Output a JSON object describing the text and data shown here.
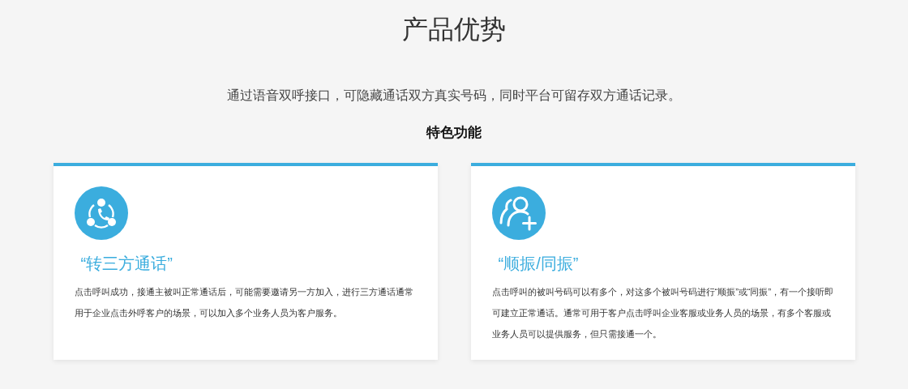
{
  "heading": "产品优势",
  "intro": "通过语音双呼接口，可隐藏通话双方真实号码，同时平台可留存双方通话记录。",
  "section_title": "特色功能",
  "features": [
    {
      "kind": "three-way-call",
      "title": "“转三方通话”",
      "description": "点击呼叫成功，接通主被叫正常通话后，可能需要邀请另一方加入，进行三方通话通常用于企业点击外呼客户的场景，可以加入多个业务人员为客户服务。"
    },
    {
      "kind": "add-user",
      "title": "“顺振/同振”",
      "description": "点击呼叫的被叫号码可以有多个，对这多个被叫号码进行“顺振”或“同振”，有一个接听即可建立正常通话。通常可用于客户点击呼叫企业客服或业务人员的场景，有多个客服或业务人员可以提供服务，但只需接通一个。"
    }
  ]
}
